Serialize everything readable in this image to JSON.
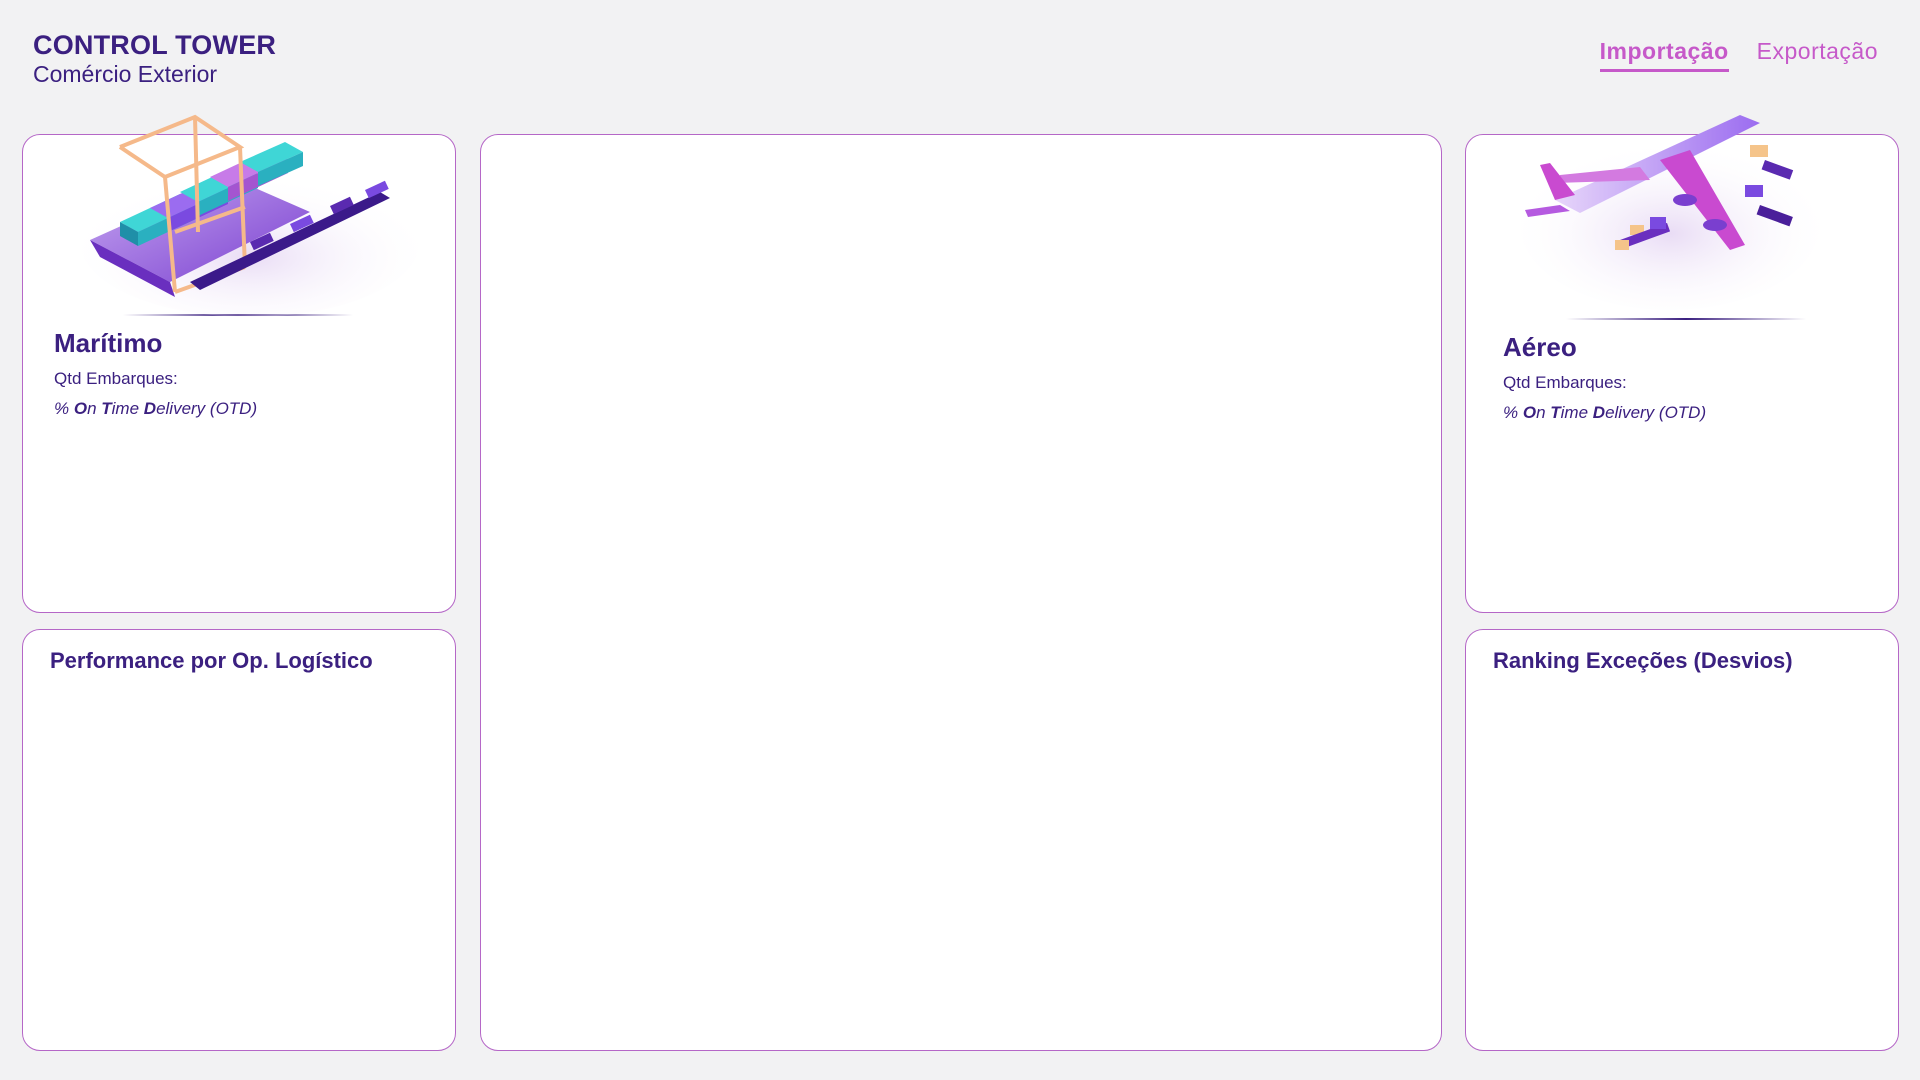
{
  "header": {
    "title": "CONTROL TOWER",
    "subtitle": "Comércio Exterior"
  },
  "tabs": [
    {
      "label": "Importação",
      "active": true
    },
    {
      "label": "Exportação",
      "active": false
    }
  ],
  "maritimo": {
    "title": "Marítimo",
    "qtd_label": "Qtd Embarques:",
    "otd": {
      "p1": "% ",
      "b1": "O",
      "t1": "n ",
      "b2": "T",
      "t2": "ime ",
      "b3": "D",
      "t3": "elivery (OTD)"
    },
    "illustration": "cargo-ship-port-icon"
  },
  "aereo": {
    "title": "Aéreo",
    "qtd_label": "Qtd Embarques:",
    "otd": {
      "p1": "% ",
      "b1": "O",
      "t1": "n ",
      "b2": "T",
      "t2": "ime ",
      "b3": "D",
      "t3": "elivery (OTD)"
    },
    "illustration": "cargo-airplane-icon"
  },
  "performance": {
    "title": "Performance por Op. Logístico"
  },
  "ranking": {
    "title": "Ranking Exceções (Desvios)"
  },
  "colors": {
    "primary": "#3b2080",
    "accent": "#c659c9",
    "border": "#b567c7",
    "background": "#f2f2f3"
  }
}
